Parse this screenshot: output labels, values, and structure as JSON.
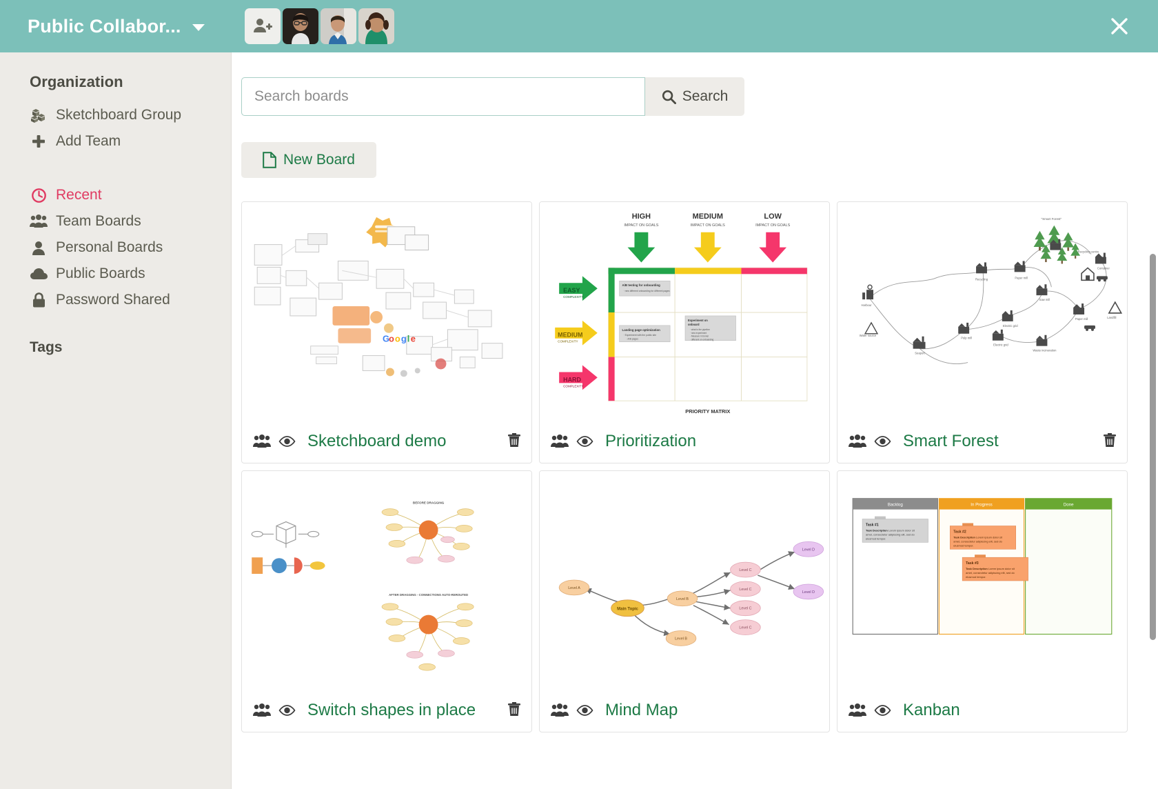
{
  "topbar": {
    "title": "Public Collabor...",
    "dropdown_icon": "chevron-down-icon",
    "close_icon": "close-icon",
    "add_user_icon": "add-user-icon",
    "avatars": [
      "user-avatar-1",
      "user-avatar-2",
      "user-avatar-3"
    ],
    "accent_color": "#7cc0b9"
  },
  "sidebar": {
    "organization_heading": "Organization",
    "org_items": [
      {
        "label": "Sketchboard Group",
        "icon": "cubes-icon"
      },
      {
        "label": "Add Team",
        "icon": "plus-icon"
      }
    ],
    "nav_items": [
      {
        "label": "Recent",
        "icon": "clock-icon",
        "active": true
      },
      {
        "label": "Team Boards",
        "icon": "users-icon",
        "active": false
      },
      {
        "label": "Personal Boards",
        "icon": "user-icon",
        "active": false
      },
      {
        "label": "Public Boards",
        "icon": "cloud-icon",
        "active": false
      },
      {
        "label": "Password Shared",
        "icon": "lock-icon",
        "active": false
      }
    ],
    "tags_heading": "Tags",
    "active_color": "#e03b62",
    "background": "#edebe7"
  },
  "search": {
    "placeholder": "Search boards",
    "value": "",
    "button_label": "Search",
    "button_icon": "search-icon"
  },
  "toolbar": {
    "new_board_label": "New Board",
    "new_board_icon": "file-icon",
    "accent_color": "#1d7a46"
  },
  "boards": [
    {
      "title": "Sketchboard demo",
      "thumb": "sketch-wireframes",
      "team_icon": "users-icon",
      "visibility_icon": "eye-icon",
      "delete_icon": "trash-icon",
      "has_delete": true
    },
    {
      "title": "Prioritization",
      "thumb": "priority-matrix",
      "team_icon": "users-icon",
      "visibility_icon": "eye-icon",
      "delete_icon": "trash-icon",
      "has_delete": false
    },
    {
      "title": "Smart Forest",
      "thumb": "smart-forest-network",
      "team_icon": "users-icon",
      "visibility_icon": "eye-icon",
      "delete_icon": "trash-icon",
      "has_delete": true
    },
    {
      "title": "Switch shapes in place",
      "thumb": "switch-shapes",
      "team_icon": "users-icon",
      "visibility_icon": "eye-icon",
      "delete_icon": "trash-icon",
      "has_delete": true
    },
    {
      "title": "Mind Map",
      "thumb": "mind-map",
      "team_icon": "users-icon",
      "visibility_icon": "eye-icon",
      "delete_icon": "trash-icon",
      "has_delete": false
    },
    {
      "title": "Kanban",
      "thumb": "kanban-board",
      "team_icon": "users-icon",
      "visibility_icon": "eye-icon",
      "delete_icon": "trash-icon",
      "has_delete": false
    }
  ],
  "thumbnails": {
    "priority_matrix": {
      "caption": "PRIORITY MATRIX",
      "columns": [
        {
          "label": "HIGH",
          "sublabel": "IMPACT ON GOALS",
          "color": "#22a44a"
        },
        {
          "label": "MEDIUM",
          "sublabel": "IMPACT ON GOALS",
          "color": "#f5cc1c"
        },
        {
          "label": "LOW",
          "sublabel": "IMPACT ON GOALS",
          "color": "#f5366b"
        }
      ],
      "rows": [
        {
          "label": "EASY",
          "sublabel": "COMPLEXITY",
          "color": "#22a44a"
        },
        {
          "label": "MEDIUM",
          "sublabel": "COMPLEXITY",
          "color": "#f5cc1c"
        },
        {
          "label": "HARD",
          "sublabel": "COMPLEXITY",
          "color": "#f5366b"
        }
      ],
      "notes": [
        {
          "title": "A/B testing for onboarding",
          "col": 0,
          "row": 0
        },
        {
          "title": "Landing page optimization",
          "col": 0,
          "row": 1
        },
        {
          "title": "Experiment on onboard",
          "col": 1,
          "row": 1
        }
      ]
    },
    "kanban": {
      "columns": [
        {
          "label": "Backlog",
          "color": "#8c8c8c"
        },
        {
          "label": "In Progress",
          "color": "#f0a020"
        },
        {
          "label": "Done",
          "color": "#6aa832"
        }
      ],
      "cards": [
        {
          "title": "Task #1",
          "desc": "Task Description",
          "column": 0,
          "color": "#d4d4d4"
        },
        {
          "title": "Task #2",
          "desc": "Task Description",
          "column": 1,
          "color": "#f9a26c"
        },
        {
          "title": "Task #3",
          "desc": "Task Description",
          "column": 1,
          "color": "#f9a26c"
        }
      ]
    },
    "mind_map": {
      "root": "Main Topic",
      "level_labels": [
        "Level A",
        "Level B",
        "Level C",
        "Level D"
      ]
    },
    "switch_shapes": {
      "caption_before": "BEFORE DRAGGING",
      "caption_after": "AFTER DRAGGING - CONNECTIONS AUTO-REROUTED"
    }
  }
}
